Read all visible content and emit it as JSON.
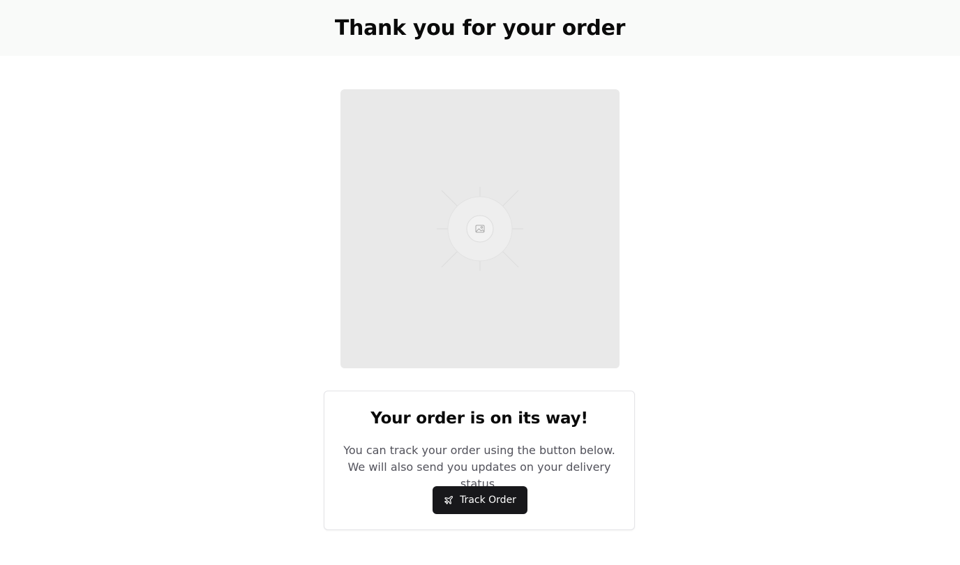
{
  "header": {
    "title": "Thank you for your order"
  },
  "hero": {
    "icon": "image-icon"
  },
  "card": {
    "title": "Your order is on its way!",
    "text": "You can track your order using the button below. We will also send you updates on your delivery status.",
    "button_label": "Track Order",
    "button_icon": "plane-icon"
  },
  "colors": {
    "header_bg": "#f9faf9",
    "button_bg": "#18181b",
    "image_placeholder_bg": "#e9e9e9",
    "muted_text": "#52525b"
  }
}
